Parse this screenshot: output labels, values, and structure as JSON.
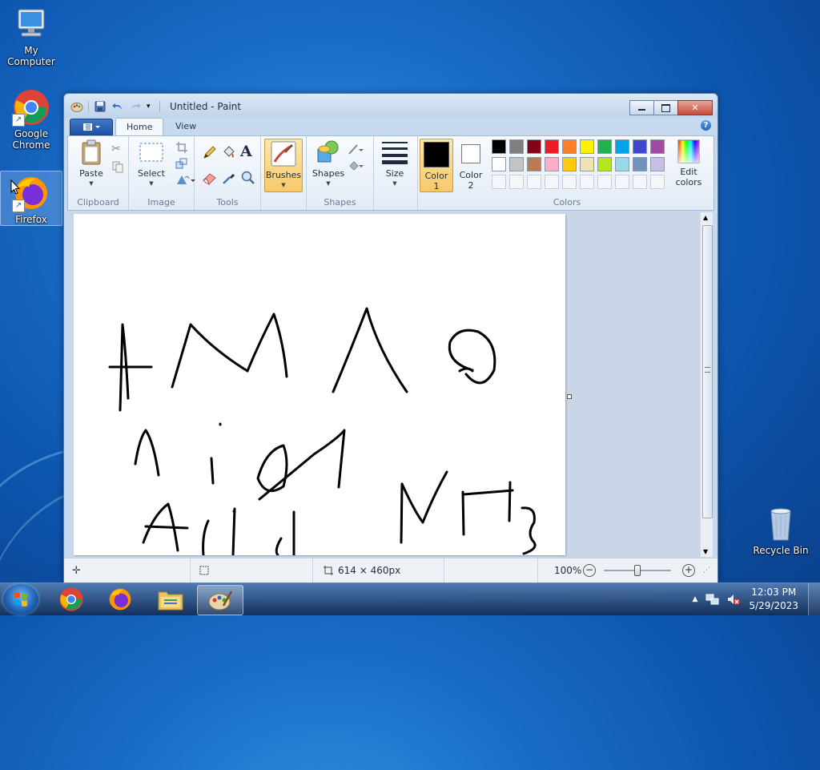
{
  "desktop": {
    "icons": [
      {
        "label": "My Computer",
        "icon": "computer-icon"
      },
      {
        "label": "Google Chrome",
        "icon": "chrome-icon"
      },
      {
        "label": "Firefox",
        "icon": "firefox-icon"
      },
      {
        "label": "Recycle Bin",
        "icon": "recycle-bin-icon"
      }
    ]
  },
  "window": {
    "title": "Untitled - Paint",
    "tabs": [
      "Home",
      "View"
    ],
    "active_tab": "Home"
  },
  "ribbon": {
    "clipboard": {
      "group_label": "Clipboard",
      "paste": "Paste"
    },
    "image": {
      "group_label": "Image",
      "select": "Select"
    },
    "tools": {
      "group_label": "Tools"
    },
    "brushes": {
      "label": "Brushes"
    },
    "shapes": {
      "group_label": "Shapes",
      "label": "Shapes"
    },
    "size": {
      "label": "Size"
    },
    "colors": {
      "group_label": "Colors",
      "color1_line1": "Color",
      "color1_line2": "1",
      "color2_line1": "Color",
      "color2_line2": "2",
      "edit_line1": "Edit",
      "edit_line2": "colors",
      "color1": "#000000",
      "color2": "#ffffff",
      "palette_row1": [
        "#000000",
        "#7f7f7f",
        "#880015",
        "#ed1c24",
        "#ff7f27",
        "#fff200",
        "#22b14c",
        "#00a2e8",
        "#3f48cc",
        "#a349a4"
      ],
      "palette_row2": [
        "#ffffff",
        "#c3c3c3",
        "#b97a57",
        "#ffaec9",
        "#ffc90e",
        "#efe4b0",
        "#b5e61d",
        "#99d9ea",
        "#7092be",
        "#c8bfe7"
      ],
      "palette_row3_empty_count": 10
    }
  },
  "status": {
    "canvas_size": "614 × 460px",
    "zoom": "100%"
  },
  "taskbar": {
    "apps": [
      {
        "name": "chrome-icon"
      },
      {
        "name": "firefox-icon"
      },
      {
        "name": "file-explorer-icon"
      },
      {
        "name": "paint-icon",
        "active": true
      }
    ],
    "clock_time": "12:03 PM",
    "clock_date": "5/29/2023"
  }
}
